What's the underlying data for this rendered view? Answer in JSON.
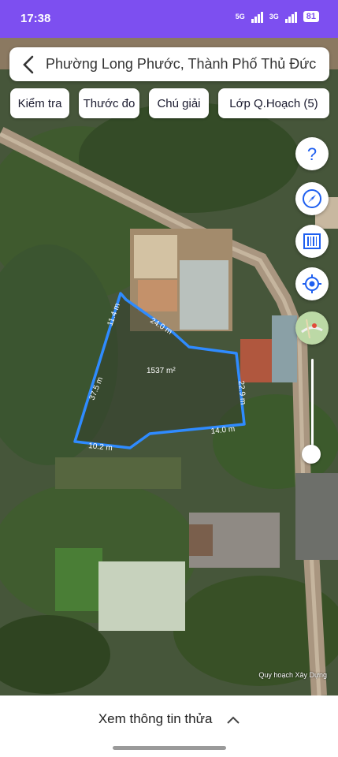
{
  "status_bar": {
    "time": "17:38",
    "network_1": "5G",
    "network_2": "3G",
    "battery": "81"
  },
  "header": {
    "title": "Phường Long Phước, Thành Phố Thủ Đức"
  },
  "toolbar": {
    "check": "Kiểm tra",
    "measure": "Thước đo",
    "legend": "Chú giải",
    "layer": "Lớp Q.Hoạch (5)"
  },
  "parcel": {
    "area": "1537 m²",
    "edges": [
      "11.4 m",
      "24.0 m",
      "22.9 m",
      "14.0 m",
      "10.2 m",
      "37.5 m"
    ],
    "outline_color": "#2f8bff"
  },
  "map": {
    "credit": "Quy hoạch Xây Dựng",
    "accent_color": "#1e5ff0"
  },
  "bottom": {
    "info_label": "Xem thông tin thửa"
  }
}
